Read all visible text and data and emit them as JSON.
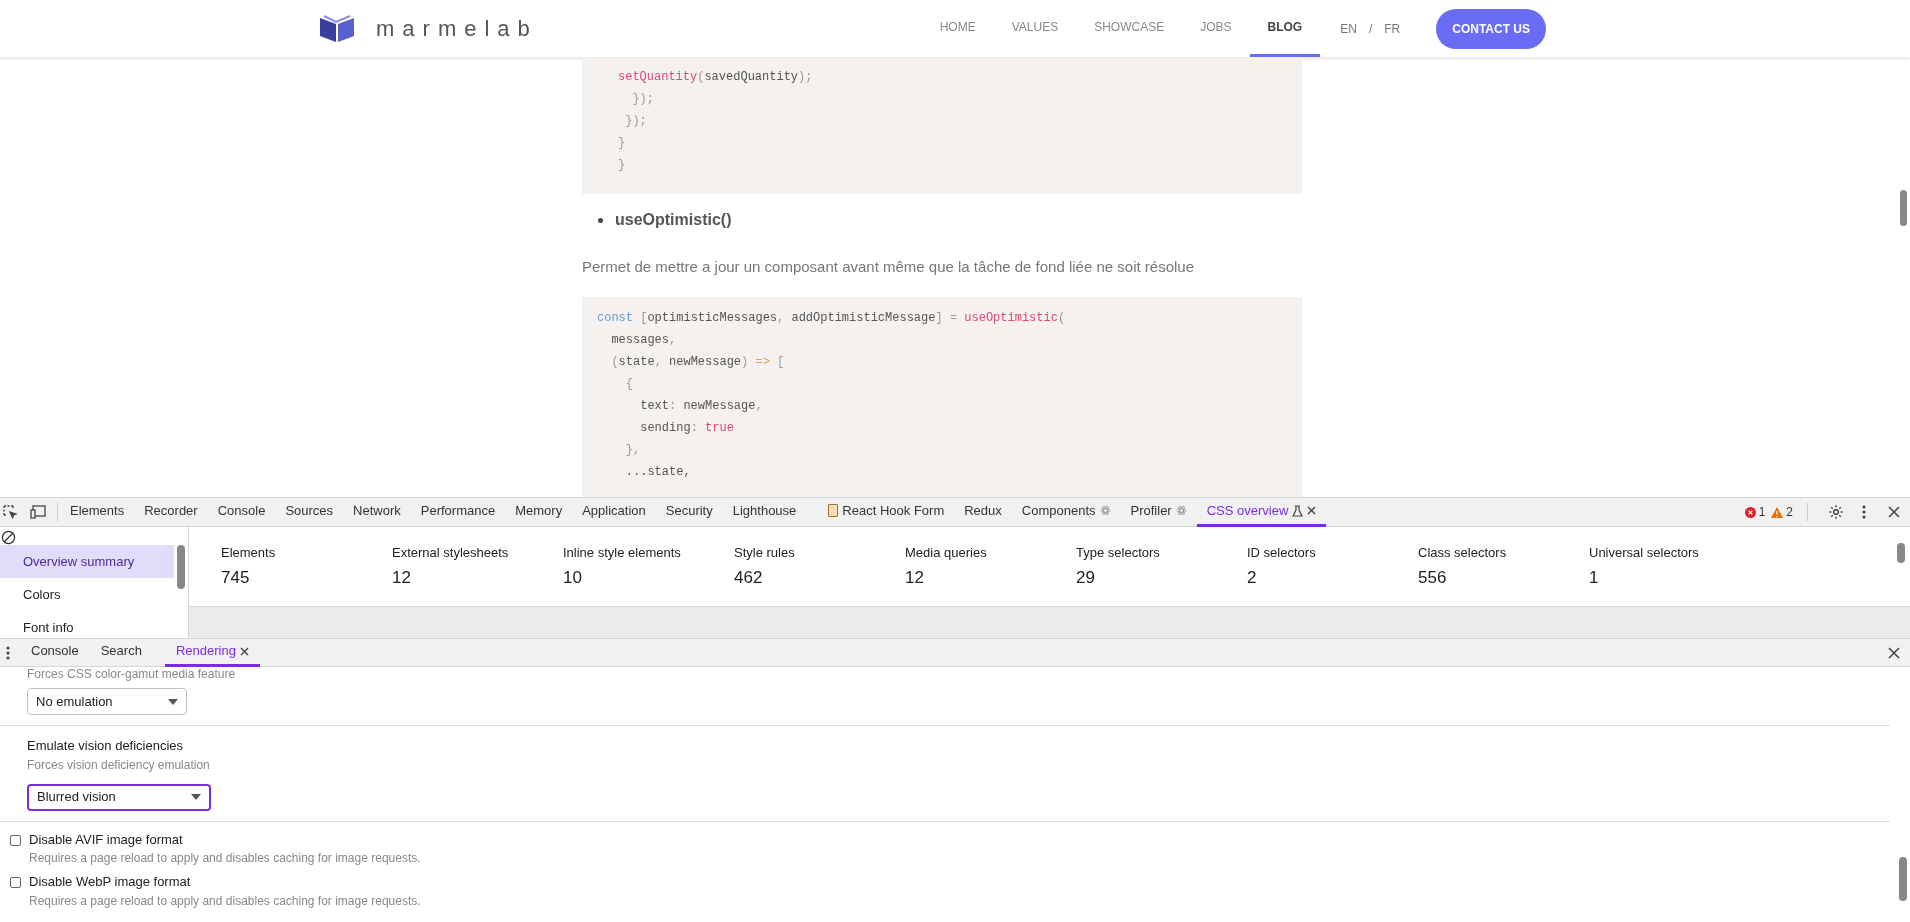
{
  "page": {
    "logo": "marmelab",
    "nav": [
      {
        "label": "HOME",
        "selected": false
      },
      {
        "label": "VALUES",
        "selected": false
      },
      {
        "label": "SHOWCASE",
        "selected": false
      },
      {
        "label": "JOBS",
        "selected": false
      },
      {
        "label": "BLOG",
        "selected": true
      }
    ],
    "languages": [
      "EN",
      "/",
      "FR"
    ],
    "contact_button": "CONTACT US",
    "code_block_1": [
      [
        {
          "kind": "func",
          "text": "setQuantity"
        },
        {
          "kind": "punct",
          "text": "("
        },
        {
          "kind": "plain",
          "text": "savedQuantity"
        },
        {
          "kind": "punct",
          "text": ");"
        }
      ],
      [
        {
          "kind": "punct",
          "text": "  });"
        }
      ],
      [
        {
          "kind": "punct",
          "text": " });"
        }
      ],
      [
        {
          "kind": "punct",
          "text": "}"
        }
      ],
      [
        {
          "kind": "punct",
          "text": "}"
        }
      ]
    ],
    "bullet": "useOptimistic()",
    "paragraph": "Permet de mettre a jour un composant avant même que la tâche de fond liée ne soit résolue",
    "code_block_2": [
      [
        {
          "kind": "keyword",
          "text": "const"
        },
        {
          "kind": "punct",
          "text": " ["
        },
        {
          "kind": "plain",
          "text": "optimisticMessages"
        },
        {
          "kind": "punct",
          "text": ", "
        },
        {
          "kind": "plain",
          "text": "addOptimisticMessage"
        },
        {
          "kind": "punct",
          "text": "] = "
        },
        {
          "kind": "func",
          "text": "useOptimistic"
        },
        {
          "kind": "punct",
          "text": "("
        }
      ],
      [
        {
          "kind": "plain",
          "text": "  messages"
        },
        {
          "kind": "punct",
          "text": ","
        }
      ],
      [
        {
          "kind": "punct",
          "text": "  ("
        },
        {
          "kind": "plain",
          "text": "state"
        },
        {
          "kind": "punct",
          "text": ", "
        },
        {
          "kind": "plain",
          "text": "newMessage"
        },
        {
          "kind": "punct",
          "text": ") "
        },
        {
          "kind": "operator",
          "text": "=>"
        },
        {
          "kind": "punct",
          "text": " ["
        }
      ],
      [
        {
          "kind": "punct",
          "text": "    {"
        }
      ],
      [
        {
          "kind": "plain",
          "text": "      text"
        },
        {
          "kind": "punct",
          "text": ": "
        },
        {
          "kind": "plain",
          "text": "newMessage"
        },
        {
          "kind": "punct",
          "text": ","
        }
      ],
      [
        {
          "kind": "plain",
          "text": "      sending"
        },
        {
          "kind": "punct",
          "text": ": "
        },
        {
          "kind": "func",
          "text": "true"
        }
      ],
      [
        {
          "kind": "punct",
          "text": "    },"
        }
      ],
      [
        {
          "kind": "plain",
          "text": "    ...state,"
        }
      ]
    ]
  },
  "devtools": {
    "tabs": [
      {
        "label": "Elements",
        "selected": false,
        "kind": "plain"
      },
      {
        "label": "Recorder",
        "selected": false,
        "kind": "plain"
      },
      {
        "label": "Console",
        "selected": false,
        "kind": "plain"
      },
      {
        "label": "Sources",
        "selected": false,
        "kind": "plain"
      },
      {
        "label": "Network",
        "selected": false,
        "kind": "plain"
      },
      {
        "label": "Performance",
        "selected": false,
        "kind": "plain"
      },
      {
        "label": "Memory",
        "selected": false,
        "kind": "plain"
      },
      {
        "label": "Application",
        "selected": false,
        "kind": "plain"
      },
      {
        "label": "Security",
        "selected": false,
        "kind": "plain"
      },
      {
        "label": "Lighthouse",
        "selected": false,
        "kind": "plain"
      },
      {
        "label": "React Hook Form",
        "selected": false,
        "kind": "clipboard"
      },
      {
        "label": "Redux",
        "selected": false,
        "kind": "plain"
      },
      {
        "label": "Components",
        "selected": false,
        "kind": "react"
      },
      {
        "label": "Profiler",
        "selected": false,
        "kind": "react"
      },
      {
        "label": "CSS overview",
        "selected": true,
        "kind": "experimental"
      }
    ],
    "errors": "1",
    "warnings": "2",
    "sidebar": [
      {
        "label": "Overview summary",
        "selected": true
      },
      {
        "label": "Colors",
        "selected": false
      },
      {
        "label": "Font info",
        "selected": false
      }
    ],
    "stats": [
      {
        "label": "Elements",
        "value": "745"
      },
      {
        "label": "External stylesheets",
        "value": "12"
      },
      {
        "label": "Inline style elements",
        "value": "10"
      },
      {
        "label": "Style rules",
        "value": "462"
      },
      {
        "label": "Media queries",
        "value": "12"
      },
      {
        "label": "Type selectors",
        "value": "29"
      },
      {
        "label": "ID selectors",
        "value": "2"
      },
      {
        "label": "Class selectors",
        "value": "556"
      },
      {
        "label": "Universal selectors",
        "value": "1"
      }
    ]
  },
  "drawer": {
    "tabs": [
      {
        "label": "Console",
        "selected": false
      },
      {
        "label": "Search",
        "selected": false
      },
      {
        "label": "Rendering",
        "selected": true
      }
    ],
    "cut_description": "Forces CSS color-gamut media feature",
    "gamut_select": {
      "value": "No emulation",
      "focused": false
    },
    "vision": {
      "title": "Emulate vision deficiencies",
      "description": "Forces vision deficiency emulation",
      "select": {
        "value": "Blurred vision",
        "focused": true
      }
    },
    "options": [
      {
        "title": "Disable AVIF image format",
        "description": "Requires a page reload to apply and disables caching for image requests.",
        "checked": false
      },
      {
        "title": "Disable WebP image format",
        "description": "Requires a page reload to apply and disables caching for image requests.",
        "checked": false
      }
    ]
  }
}
